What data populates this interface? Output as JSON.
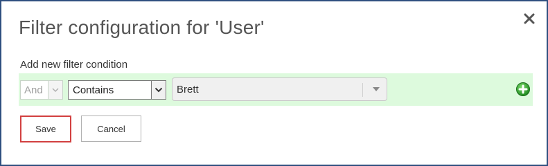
{
  "dialog": {
    "title": "Filter configuration for 'User'",
    "close_icon": "close-icon"
  },
  "filter": {
    "section_label": "Add new filter condition",
    "conjunction": {
      "value": "And",
      "disabled": true
    },
    "operator": {
      "value": "Contains"
    },
    "value": {
      "value": "Brett"
    },
    "add_icon": "plus-circle-icon"
  },
  "actions": {
    "save_label": "Save",
    "cancel_label": "Cancel"
  },
  "colors": {
    "border": "#2f4f7f",
    "filter_row_bg": "#ddfadd",
    "save_highlight": "#d24040",
    "add_icon": "#2e9e2e"
  }
}
